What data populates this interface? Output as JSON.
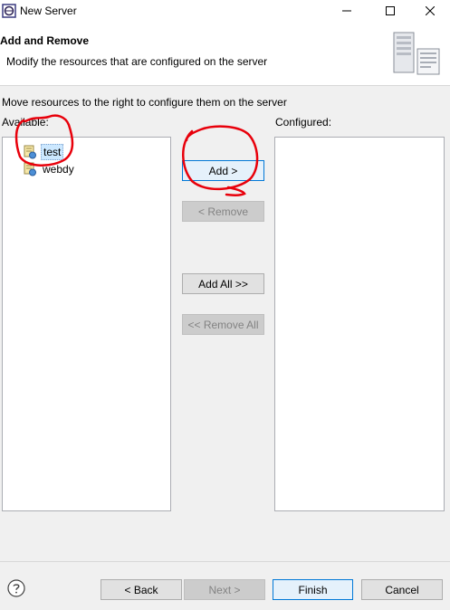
{
  "window": {
    "title": "New Server",
    "controls": [
      "minimize-icon",
      "maximize-icon",
      "close-icon"
    ]
  },
  "header": {
    "title": "Add and Remove",
    "description": "Modify the resources that are configured on the server"
  },
  "body": {
    "instruction": "Move resources to the right to configure them on the server",
    "available_label": "Available:",
    "configured_label": "Configured:",
    "available_items": [
      {
        "label": "test",
        "icon": "web-module-icon",
        "selected": true
      },
      {
        "label": "webdy",
        "icon": "web-module-icon",
        "selected": false
      }
    ],
    "configured_items": []
  },
  "actions": {
    "add": "Add >",
    "remove": "< Remove",
    "add_all": "Add All >>",
    "remove_all": "<< Remove All"
  },
  "footer": {
    "back": "< Back",
    "next": "Next >",
    "finish": "Finish",
    "cancel": "Cancel"
  },
  "colors": {
    "selection": "#cce8ff",
    "default_button_border": "#0078d7",
    "annotation": "#e8000b"
  }
}
